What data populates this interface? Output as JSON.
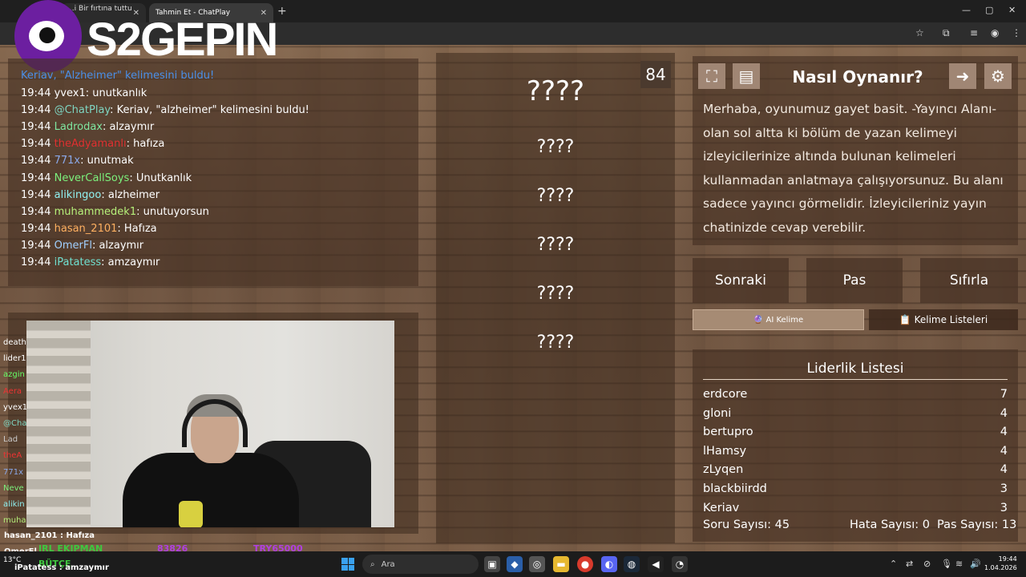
{
  "browser": {
    "tabs": [
      {
        "title": "...i Bir fırtına tuttu bi"
      },
      {
        "title": "Tahmin Et - ChatPlay"
      }
    ],
    "new_tab": "+",
    "close": "✕"
  },
  "logo": {
    "text": "S2GEPIN"
  },
  "chat": {
    "header": "Keriav, \"Alzheimer\" kelimesini buldu!",
    "messages": [
      {
        "time": "19:44",
        "user": "yvex1",
        "text": ": unutkanlık",
        "color": "#ffffff"
      },
      {
        "time": "19:44",
        "user": "@ChatPlay",
        "text": ": Keriav, \"alzheimer\" kelimesini buldu!",
        "color": "#7fd6c2"
      },
      {
        "time": "19:44",
        "user": "Ladrodax",
        "text": ": alzaymır",
        "color": "#7fe6a0"
      },
      {
        "time": "19:44",
        "user": "theAdyamanlı",
        "text": ": hafıza",
        "color": "#e03030"
      },
      {
        "time": "19:44",
        "user": "771x",
        "text": ": unutmak",
        "color": "#8aa8e8"
      },
      {
        "time": "19:44",
        "user": "NeverCallSoys",
        "text": ": Unutkanlık",
        "color": "#7cf07c"
      },
      {
        "time": "19:44",
        "user": "alikingoo",
        "text": ": alzheimer",
        "color": "#8ff0f0"
      },
      {
        "time": "19:44",
        "user": "muhammedek1",
        "text": ": unutuyorsun",
        "color": "#b6f07a"
      },
      {
        "time": "19:44",
        "user": "hasan_2101",
        "text": ": Hafıza",
        "color": "#ffb060"
      },
      {
        "time": "19:44",
        "user": "OmerFl",
        "text": ": alzaymır",
        "color": "#a0d0ff"
      },
      {
        "time": "19:44",
        "user": "iPatatess",
        "text": ": amzaymır",
        "color": "#70e0d0"
      }
    ]
  },
  "game": {
    "counter": "84",
    "words": [
      "????",
      "????",
      "????",
      "????",
      "????",
      "????"
    ]
  },
  "info": {
    "title": "Nasıl Oynanır?",
    "text": "Merhaba, oyunumuz gayet basit. -Yayıncı Alanı- olan sol altta ki bölüm de yazan kelimeyi izleyicilerinize altında bulunan kelimeleri kullanmadan anlatmaya çalışıyorsunuz. Bu alanı sadece yayıncı görmelidir. İzleyicileriniz yayın chatinizde cevap verebilir."
  },
  "buttons": {
    "next": "Sonraki",
    "pass": "Pas",
    "reset": "Sıfırla"
  },
  "tabs": {
    "ai": "🔮 AI Kelime",
    "lists": "📋 Kelime Listeleri"
  },
  "leaderboard": {
    "title": "Liderlik Listesi",
    "rows": [
      {
        "name": "erdcore",
        "score": "7"
      },
      {
        "name": "gloni",
        "score": "4"
      },
      {
        "name": "bertupro",
        "score": "4"
      },
      {
        "name": "lHamsy",
        "score": "4"
      },
      {
        "name": "zLyqen",
        "score": "4"
      },
      {
        "name": "blackbiirdd",
        "score": "3"
      },
      {
        "name": "Keriav",
        "score": "3"
      }
    ]
  },
  "stats": {
    "questions": "Soru Sayısı: 45",
    "errors": "Hata Sayısı: 0",
    "passes": "Pas Sayısı: 13"
  },
  "overlay": {
    "side_chat": [
      "death",
      "lider1",
      "azgin",
      "Aera",
      "yvex1",
      "@Cha",
      "Lad",
      "theA",
      "771x",
      "Neve",
      "alikin",
      "muha"
    ],
    "bottom_chat_1": "hasan_2101 : Hafıza",
    "bottom_chat_2": "OmerFl",
    "bottom_chat_3": "iPatatess : amzaymır",
    "promo_1": "IRL EKIPMAN",
    "promo_2": "BÜTÇE",
    "promo_3": "83826",
    "promo_4": "TRY65000"
  },
  "taskbar": {
    "search": "Ara",
    "time": "19:44",
    "date": "1.04.2026",
    "weather": "13°C"
  }
}
